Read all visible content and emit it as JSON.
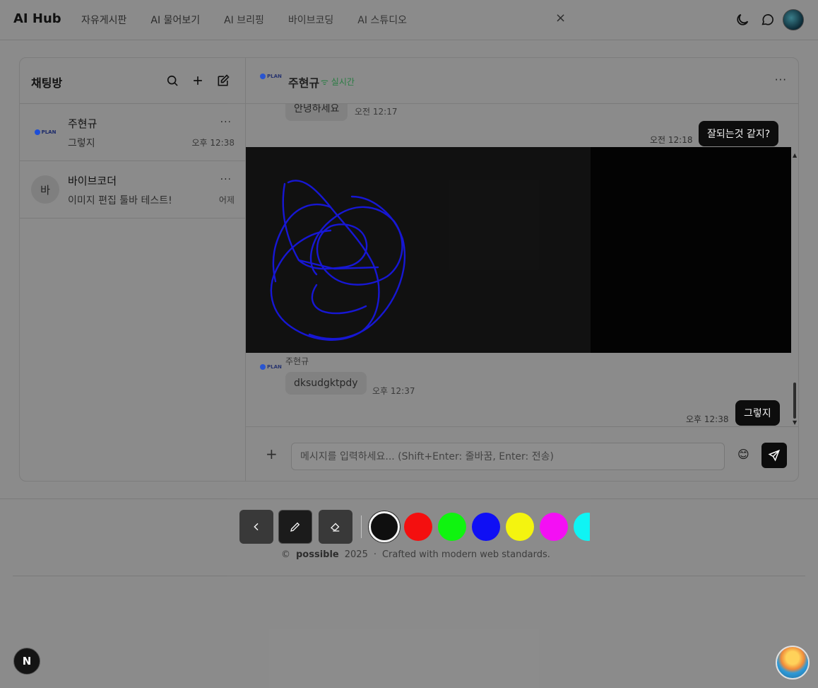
{
  "header": {
    "logo": "AI Hub",
    "nav": [
      "자유게시판",
      "AI 물어보기",
      "AI 브리핑",
      "바이브코딩",
      "AI 스튜디오"
    ],
    "close_symbol": "×",
    "icons": [
      "moon-icon",
      "chat-bubble-icon",
      "user-avatar"
    ]
  },
  "sidebar": {
    "title": "채팅방",
    "icons": [
      "search-icon",
      "plus-icon",
      "edit-icon"
    ],
    "rooms": [
      {
        "avatar": "PLAN",
        "name": "주현규",
        "preview": "그렇지",
        "time": "오후 12:38",
        "more": "···"
      },
      {
        "avatar": "바",
        "name": "바이브코더",
        "preview": "이미지 편집 툴바 테스트!",
        "time": "어제",
        "more": "···"
      }
    ]
  },
  "chat": {
    "name": "주현규",
    "status": "실시간",
    "more": "···",
    "messages": [
      {
        "side": "left",
        "text": "안녕하세요",
        "time": "오전 12:17"
      },
      {
        "side": "right",
        "text": "잘되는것 같지?",
        "time": "오전 12:18"
      },
      {
        "side": "left",
        "sender": "주현규",
        "text": "dksudgktpdy",
        "time": "오후 12:37"
      },
      {
        "side": "right",
        "text": "그렇지",
        "time": "오후 12:38"
      }
    ],
    "input_placeholder": "메시지를 입력하세요... (Shift+Enter: 줄바꿈, Enter: 전송)",
    "emoji": "😊",
    "plus": "+"
  },
  "drawing_toolbar": {
    "buttons": [
      "back-button",
      "pen-button",
      "eraser-button"
    ],
    "colors": [
      "#000000",
      "#ff0000",
      "#00ff00",
      "#0000ff",
      "#ffff00",
      "#ff00ff",
      "#00ffff"
    ],
    "selected_color": "#000000",
    "stroke_color": "#0a0adc"
  },
  "footer": {
    "copyright_symbol": "©",
    "brand": "possible",
    "year": "2025",
    "separator": "·",
    "tagline": "Crafted with modern web standards."
  },
  "badges": {
    "next": "N"
  }
}
